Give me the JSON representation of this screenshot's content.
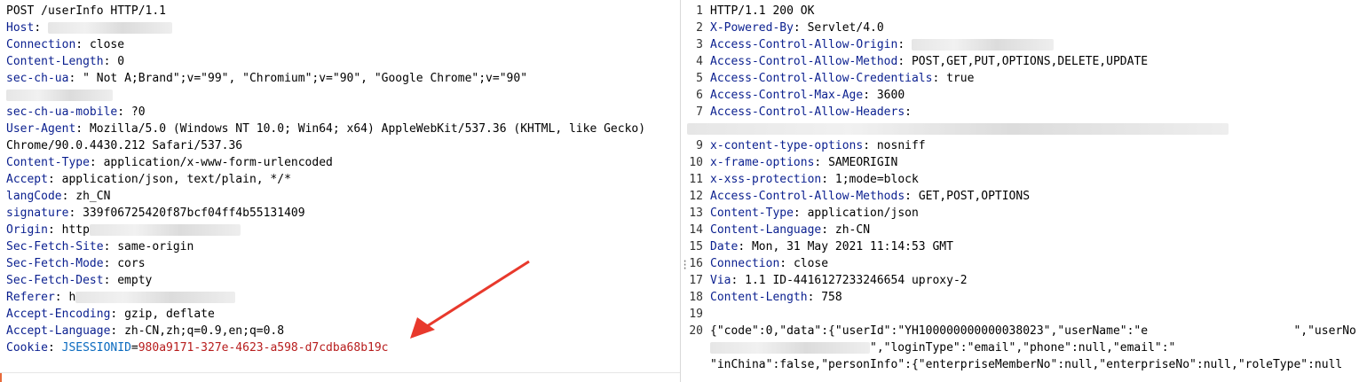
{
  "request": {
    "request_line": "POST /userInfo HTTP/1.1",
    "headers": [
      {
        "key": "Host",
        "value": ""
      },
      {
        "key": "Connection",
        "value": "close"
      },
      {
        "key": "Content-Length",
        "value": "0"
      },
      {
        "key": "sec-ch-ua",
        "value": "\" Not A;Brand\";v=\"99\", \"Chromium\";v=\"90\", \"Google Chrome\";v=\"90\""
      },
      {
        "key": "sec-ch-ua-mobile",
        "value": "?0"
      },
      {
        "key": "User-Agent",
        "value": "Mozilla/5.0 (Windows NT 10.0; Win64; x64) AppleWebKit/537.36 (KHTML, like Gecko)"
      },
      {
        "key": "",
        "value": "Chrome/90.0.4430.212 Safari/537.36"
      },
      {
        "key": "Content-Type",
        "value": "application/x-www-form-urlencoded"
      },
      {
        "key": "Accept",
        "value": "application/json, text/plain, */*"
      },
      {
        "key": "langCode",
        "value": "zh_CN"
      },
      {
        "key": "signature",
        "value": "339f06725420f87bcf04ff4b55131409"
      },
      {
        "key": "Origin",
        "value": "http"
      },
      {
        "key": "Sec-Fetch-Site",
        "value": "same-origin"
      },
      {
        "key": "Sec-Fetch-Mode",
        "value": "cors"
      },
      {
        "key": "Sec-Fetch-Dest",
        "value": "empty"
      },
      {
        "key": "Referer",
        "value": "h"
      },
      {
        "key": "Accept-Encoding",
        "value": "gzip, deflate"
      },
      {
        "key": "Accept-Language",
        "value": "zh-CN,zh;q=0.9,en;q=0.8"
      }
    ],
    "cookie": {
      "key": "Cookie",
      "name": "JSESSIONID",
      "value": "980a9171-327e-4623-a598-d7cdba68b19c"
    }
  },
  "response": {
    "lines": [
      {
        "n": "1",
        "key": "",
        "value": "HTTP/1.1 200 OK"
      },
      {
        "n": "2",
        "key": "X-Powered-By",
        "value": "Servlet/4.0"
      },
      {
        "n": "3",
        "key": "Access-Control-Allow-Origin",
        "value": ""
      },
      {
        "n": "4",
        "key": "Access-Control-Allow-Method",
        "value": "POST,GET,PUT,OPTIONS,DELETE,UPDATE"
      },
      {
        "n": "5",
        "key": "Access-Control-Allow-Credentials",
        "value": "true"
      },
      {
        "n": "6",
        "key": "Access-Control-Max-Age",
        "value": "3600"
      },
      {
        "n": "7",
        "key": "Access-Control-Allow-Headers",
        "value": ""
      },
      {
        "n": "",
        "key": "",
        "value": ""
      },
      {
        "n": "9",
        "key": "x-content-type-options",
        "value": "nosniff"
      },
      {
        "n": "10",
        "key": "x-frame-options",
        "value": "SAMEORIGIN"
      },
      {
        "n": "11",
        "key": "x-xss-protection",
        "value": "1;mode=block"
      },
      {
        "n": "12",
        "key": "Access-Control-Allow-Methods",
        "value": "GET,POST,OPTIONS"
      },
      {
        "n": "13",
        "key": "Content-Type",
        "value": "application/json"
      },
      {
        "n": "14",
        "key": "Content-Language",
        "value": "zh-CN"
      },
      {
        "n": "15",
        "key": "Date",
        "value": "Mon, 31 May 2021 11:14:53 GMT"
      },
      {
        "n": "16",
        "key": "Connection",
        "value": "close"
      },
      {
        "n": "17",
        "key": "Via",
        "value": "1.1 ID-4416127233246654 uproxy-2"
      },
      {
        "n": "18",
        "key": "Content-Length",
        "value": "758"
      },
      {
        "n": "19",
        "key": "",
        "value": ""
      },
      {
        "n": "20",
        "key": "",
        "value": "{\"code\":0,\"data\":{\"userId\":\"YH100000000000038023\",\"userName\":\"e                     \",\"userNo"
      }
    ],
    "body_line2": "\",\"loginType\":\"email\",\"phone\":null,\"email\":\"",
    "body_line3": "\"inChina\":false,\"personInfo\":{\"enterpriseMemberNo\":null,\"enterpriseNo\":null,\"roleType\":null"
  }
}
